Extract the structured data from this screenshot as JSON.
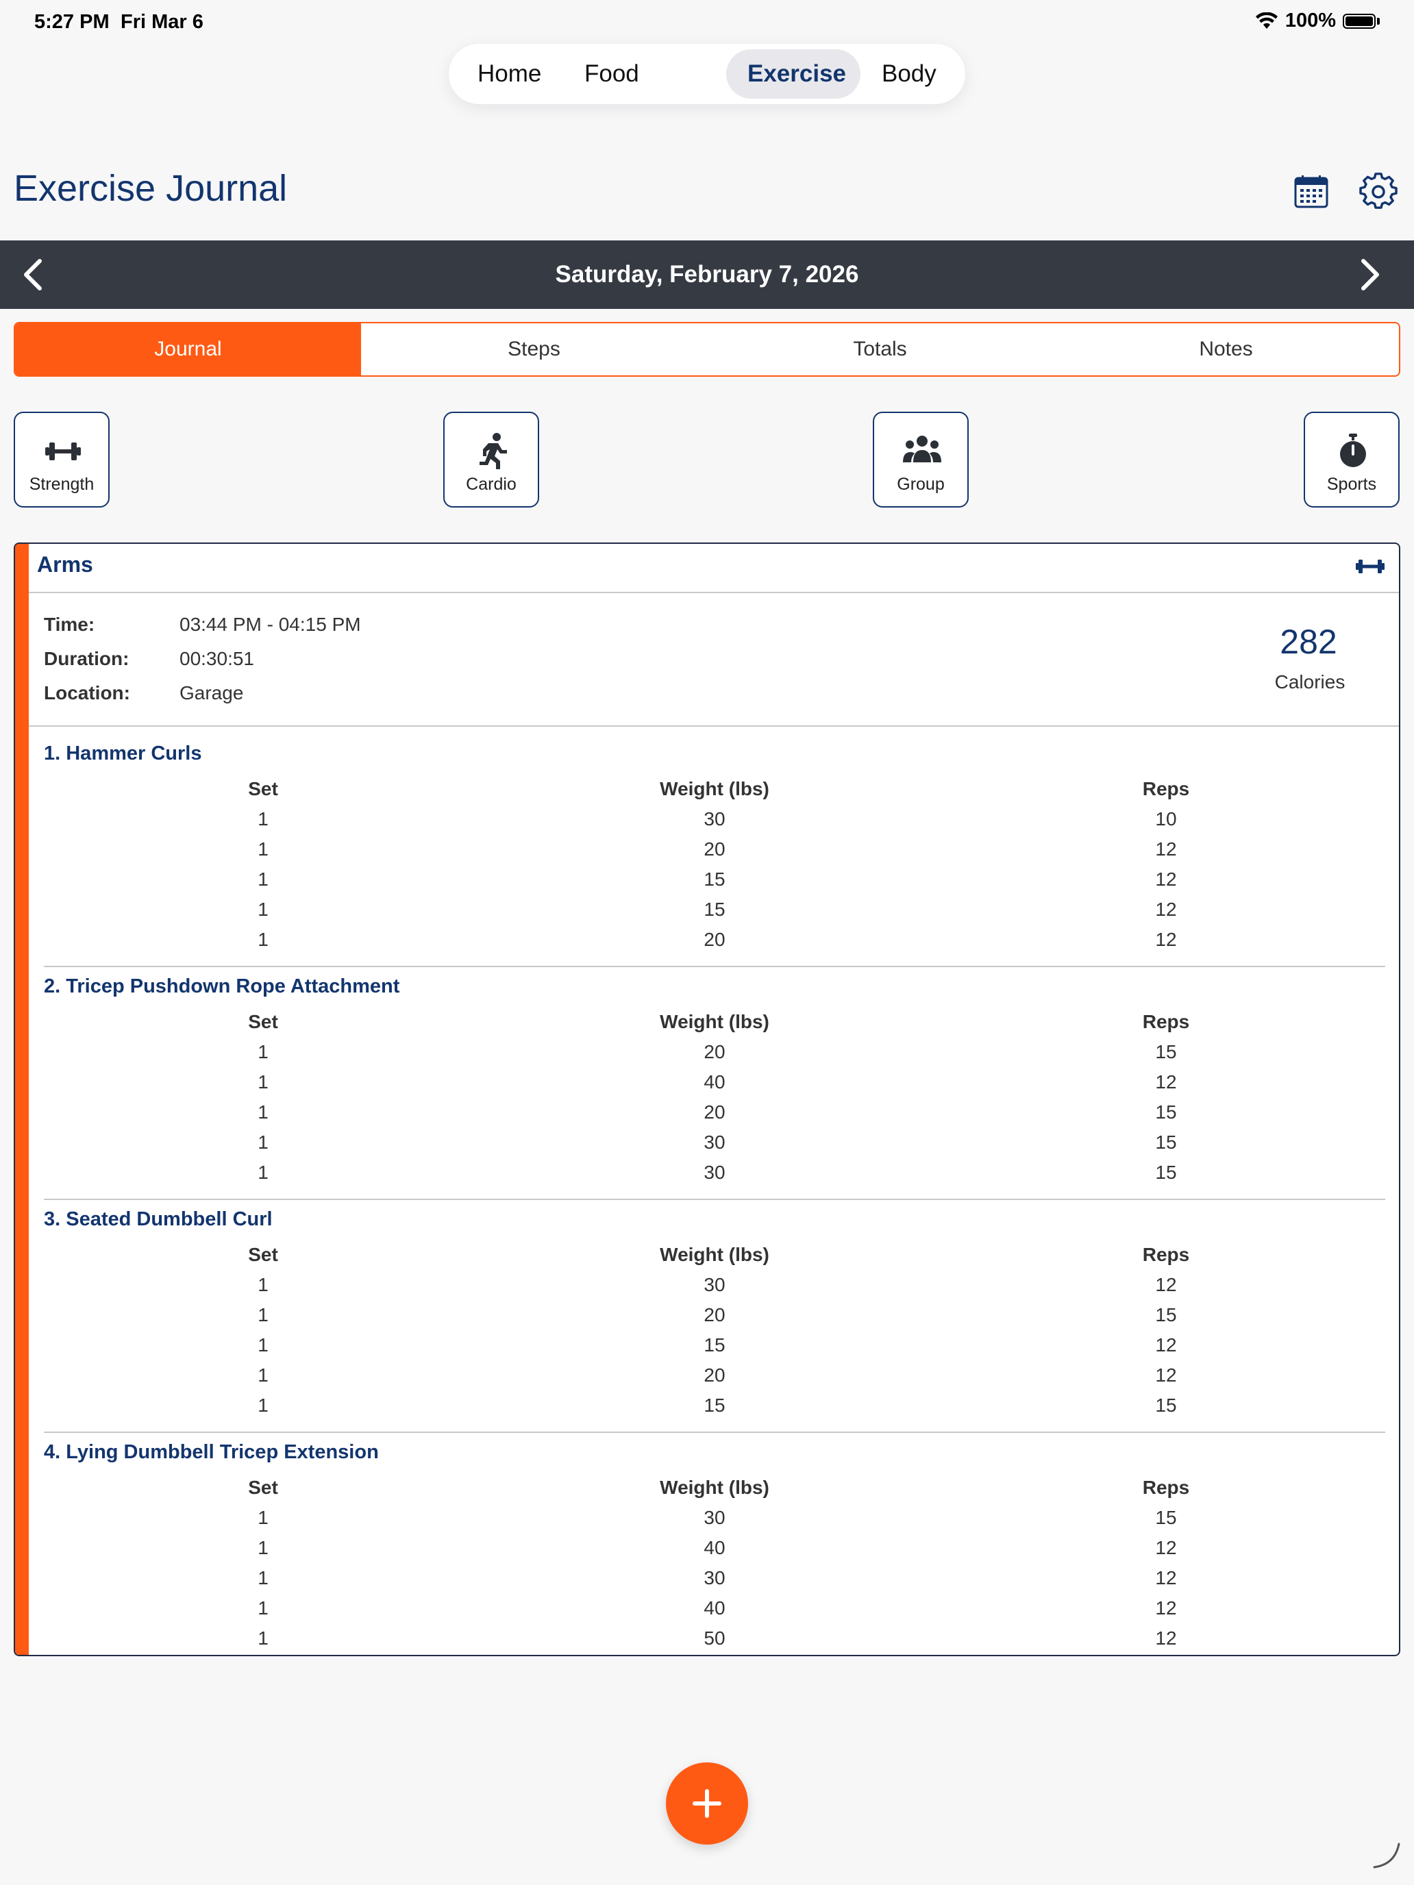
{
  "status": {
    "time": "5:27 PM",
    "date": "Fri Mar 6",
    "battery": "100%"
  },
  "nav": {
    "items": [
      "Home",
      "Food",
      "Exercise",
      "Body"
    ],
    "active": "Exercise"
  },
  "header": {
    "title": "Exercise Journal"
  },
  "datebar": {
    "date": "Saturday, February 7, 2026"
  },
  "tabs": {
    "items": [
      "Journal",
      "Steps",
      "Totals",
      "Notes"
    ],
    "active": "Journal"
  },
  "categories": [
    {
      "label": "Strength",
      "icon": "dumbbell-icon"
    },
    {
      "label": "Cardio",
      "icon": "runner-icon"
    },
    {
      "label": "Group",
      "icon": "group-icon"
    },
    {
      "label": "Sports",
      "icon": "stopwatch-icon"
    }
  ],
  "workout": {
    "title": "Arms",
    "time_label": "Time:",
    "time_value": "03:44 PM - 04:15 PM",
    "duration_label": "Duration:",
    "duration_value": "00:30:51",
    "location_label": "Location:",
    "location_value": "Garage",
    "calories_value": "282",
    "calories_label": "Calories",
    "columns": [
      "Set",
      "Weight (lbs)",
      "Reps"
    ],
    "exercises": [
      {
        "name": "1. Hammer Curls",
        "sets": [
          [
            "1",
            "30",
            "10"
          ],
          [
            "1",
            "20",
            "12"
          ],
          [
            "1",
            "15",
            "12"
          ],
          [
            "1",
            "15",
            "12"
          ],
          [
            "1",
            "20",
            "12"
          ]
        ]
      },
      {
        "name": "2. Tricep Pushdown Rope Attachment",
        "sets": [
          [
            "1",
            "20",
            "15"
          ],
          [
            "1",
            "40",
            "12"
          ],
          [
            "1",
            "20",
            "15"
          ],
          [
            "1",
            "30",
            "15"
          ],
          [
            "1",
            "30",
            "15"
          ]
        ]
      },
      {
        "name": "3. Seated Dumbbell Curl",
        "sets": [
          [
            "1",
            "30",
            "12"
          ],
          [
            "1",
            "20",
            "15"
          ],
          [
            "1",
            "15",
            "12"
          ],
          [
            "1",
            "20",
            "12"
          ],
          [
            "1",
            "15",
            "15"
          ]
        ]
      },
      {
        "name": "4. Lying Dumbbell Tricep Extension",
        "sets": [
          [
            "1",
            "30",
            "15"
          ],
          [
            "1",
            "40",
            "12"
          ],
          [
            "1",
            "30",
            "12"
          ],
          [
            "1",
            "40",
            "12"
          ],
          [
            "1",
            "50",
            "12"
          ]
        ]
      }
    ]
  },
  "colors": {
    "accent": "#ff5a14",
    "navy": "#13356e",
    "datebar": "#353a43"
  }
}
